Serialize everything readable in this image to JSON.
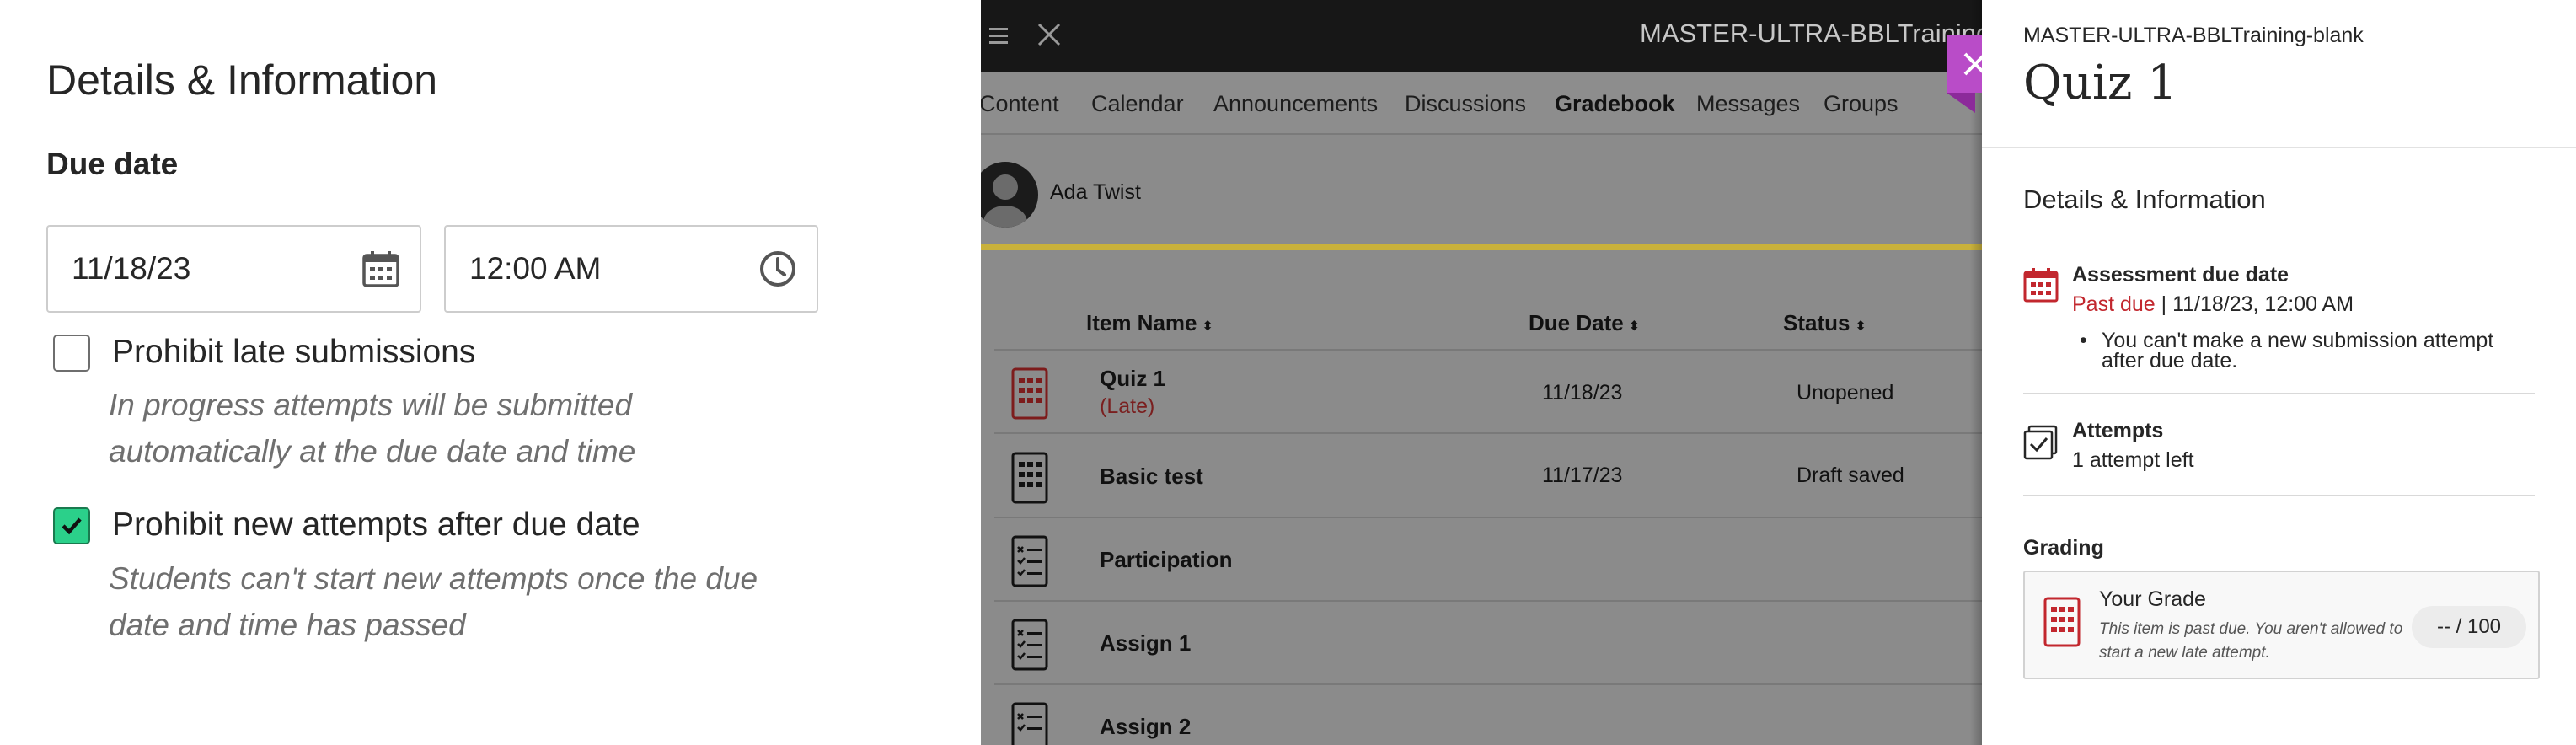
{
  "left_panel": {
    "title": "Details & Information",
    "due_date_heading": "Due date",
    "date_value": "11/18/23",
    "time_value": "12:00 AM",
    "options": [
      {
        "label": "Prohibit late submissions",
        "checked": false,
        "help_line1": "In progress attempts will be submitted",
        "help_line2": "automatically at the due date and time"
      },
      {
        "label": "Prohibit new attempts after due date",
        "checked": true,
        "help_line1": "Students can't start new attempts once the due",
        "help_line2": "date and time has passed"
      }
    ]
  },
  "app": {
    "course_title": "MASTER-ULTRA-BBLTraining-bl",
    "nav_tabs": [
      "Content",
      "Calendar",
      "Announcements",
      "Discussions",
      "Gradebook",
      "Messages",
      "Groups"
    ],
    "active_tab": "Gradebook",
    "student_name": "Ada Twist",
    "columns": {
      "item_name": "Item Name",
      "due_date": "Due Date",
      "status": "Status"
    },
    "rows": [
      {
        "name": "Quiz 1",
        "late": "(Late)",
        "due": "11/18/23",
        "status": "Unopened",
        "icon": "quiz-late-icon"
      },
      {
        "name": "Basic test",
        "late": "",
        "due": "11/17/23",
        "status": "Draft saved",
        "icon": "test-icon"
      },
      {
        "name": "Participation",
        "late": "",
        "due": "",
        "status": "",
        "icon": "assignment-icon"
      },
      {
        "name": "Assign 1",
        "late": "",
        "due": "",
        "status": "",
        "icon": "assignment-icon"
      },
      {
        "name": "Assign 2",
        "late": "",
        "due": "",
        "status": "",
        "icon": "assignment-icon"
      }
    ]
  },
  "details_panel": {
    "course": "MASTER-ULTRA-BBLTraining-blank",
    "title": "Quiz 1",
    "section_title": "Details & Information",
    "due_heading": "Assessment due date",
    "past_due": "Past due",
    "due_value": "11/18/23, 12:00 AM",
    "due_note": "You can't make a new submission attempt after due date.",
    "attempts_heading": "Attempts",
    "attempts_value": "1 attempt left",
    "grading_heading": "Grading",
    "grade_title": "Your Grade",
    "grade_note": "This item is past due. You aren't allowed to start a new late attempt.",
    "grade_value": "-- / 100"
  },
  "colors": {
    "late_red": "#c2272e",
    "close_purple": "#b94cc8",
    "check_green": "#2bd08a",
    "gold_accent": "#c9b13b"
  }
}
